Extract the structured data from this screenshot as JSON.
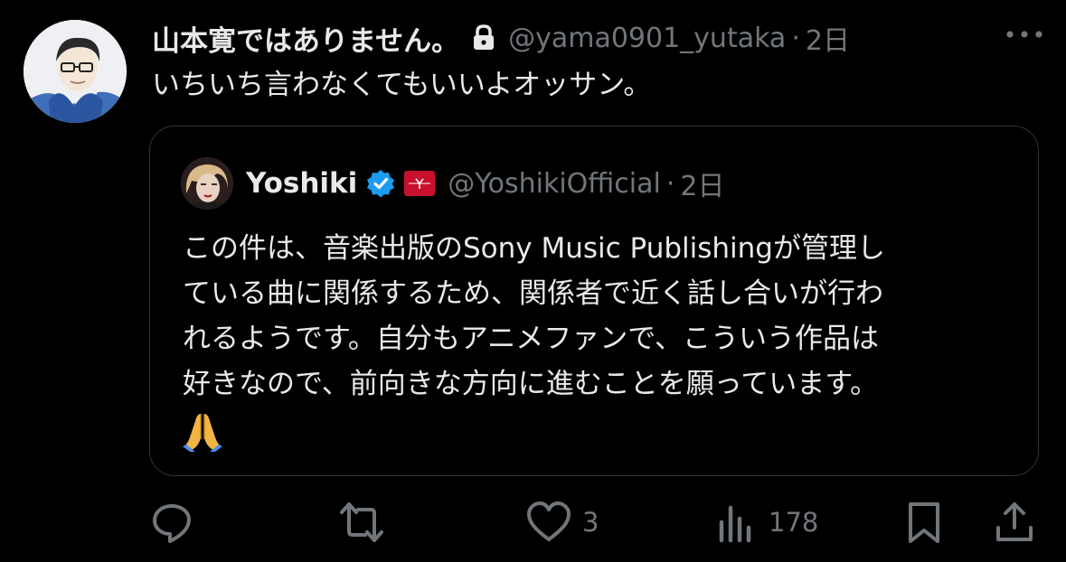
{
  "tweet": {
    "author_name": "山本寛ではありません。",
    "author_handle": "@yama0901_yutaka",
    "separator": "·",
    "time": "2日",
    "text": "いちいち言わなくてもいいよオッサン。",
    "icons": {
      "lock": "lock-icon",
      "more": "more-options-icon"
    }
  },
  "quote": {
    "author_name": "Yoshiki",
    "author_handle": "@YoshikiOfficial",
    "separator": "·",
    "time": "2日",
    "lines": [
      "この件は、音楽出版のSony Music Publishingが管理し",
      "ている曲に関係するため、関係者で近く話し合いが行わ",
      "れるようです。自分もアニメファンで、こういう作品は",
      "好きなので、前向きな方向に進むことを願っています。"
    ],
    "emoji": "folded-hands-emoji",
    "badges": {
      "verified": "verified-badge-icon",
      "affiliation": "affiliation-badge-icon"
    }
  },
  "actions": {
    "reply": {
      "icon": "reply-icon",
      "count": ""
    },
    "repost": {
      "icon": "repost-icon",
      "count": ""
    },
    "like": {
      "icon": "like-icon",
      "count": "3"
    },
    "views": {
      "icon": "views-icon",
      "count": "178"
    },
    "bookmark": {
      "icon": "bookmark-icon",
      "count": ""
    },
    "share": {
      "icon": "share-icon",
      "count": ""
    }
  },
  "colors": {
    "background": "#000000",
    "text": "#e7e9ea",
    "muted": "#71767b",
    "border": "#2f3336",
    "verified": "#1d9bf0",
    "badge": "#c8102e"
  }
}
